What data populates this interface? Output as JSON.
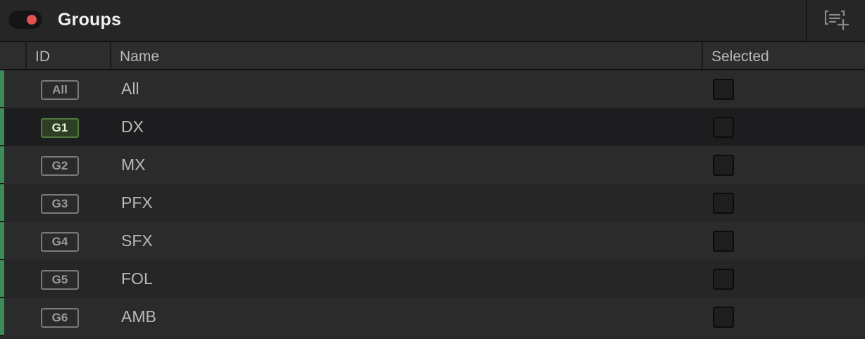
{
  "header": {
    "title": "Groups",
    "toggle_color": "#e2534d",
    "add_icon": "add-group-icon"
  },
  "columns": {
    "id": "ID",
    "name": "Name",
    "selected": "Selected"
  },
  "rows": [
    {
      "id": "All",
      "name": "All",
      "selected": false,
      "active": false
    },
    {
      "id": "G1",
      "name": "DX",
      "selected": false,
      "active": true
    },
    {
      "id": "G2",
      "name": "MX",
      "selected": false,
      "active": false
    },
    {
      "id": "G3",
      "name": "PFX",
      "selected": false,
      "active": false
    },
    {
      "id": "G4",
      "name": "SFX",
      "selected": false,
      "active": false
    },
    {
      "id": "G5",
      "name": "FOL",
      "selected": false,
      "active": false
    },
    {
      "id": "G6",
      "name": "AMB",
      "selected": false,
      "active": false
    }
  ],
  "colors": {
    "accent_stripe": "#3e8a58",
    "active_badge": "#2c3f22"
  }
}
